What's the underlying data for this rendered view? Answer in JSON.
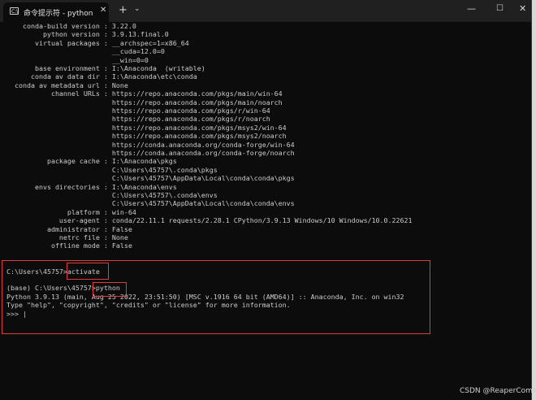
{
  "titlebar": {
    "tab_title": "命令提示符 - python",
    "tab_icon": "C:\\",
    "close_tab": "✕",
    "new_tab": "+",
    "dropdown": "⌄",
    "minimize": "—",
    "maximize": "☐",
    "close": "✕"
  },
  "console": {
    "lines": [
      "    conda-build version : 3.22.0",
      "         python version : 3.9.13.final.0",
      "       virtual packages : __archspec=1=x86_64",
      "                          __cuda=12.0=0",
      "                          __win=0=0",
      "       base environment : I:\\Anaconda  (writable)",
      "      conda av data dir : I:\\Anaconda\\etc\\conda",
      "  conda av metadata url : None",
      "           channel URLs : https://repo.anaconda.com/pkgs/main/win-64",
      "                          https://repo.anaconda.com/pkgs/main/noarch",
      "                          https://repo.anaconda.com/pkgs/r/win-64",
      "                          https://repo.anaconda.com/pkgs/r/noarch",
      "                          https://repo.anaconda.com/pkgs/msys2/win-64",
      "                          https://repo.anaconda.com/pkgs/msys2/noarch",
      "                          https://conda.anaconda.org/conda-forge/win-64",
      "                          https://conda.anaconda.org/conda-forge/noarch",
      "          package cache : I:\\Anaconda\\pkgs",
      "                          C:\\Users\\45757\\.conda\\pkgs",
      "                          C:\\Users\\45757\\AppData\\Local\\conda\\conda\\pkgs",
      "       envs directories : I:\\Anaconda\\envs",
      "                          C:\\Users\\45757\\.conda\\envs",
      "                          C:\\Users\\45757\\AppData\\Local\\conda\\conda\\envs",
      "               platform : win-64",
      "             user-agent : conda/22.11.1 requests/2.28.1 CPython/3.9.13 Windows/10 Windows/10.0.22621",
      "          administrator : False",
      "             netrc file : None",
      "           offline mode : False",
      "",
      "",
      "C:\\Users\\45757>activate",
      "",
      "(base) C:\\Users\\45757>python",
      "Python 3.9.13 (main, Aug 25 2022, 23:51:50) [MSC v.1916 64 bit (AMD64)] :: Anaconda, Inc. on win32",
      "Type \"help\", \"copyright\", \"credits\" or \"license\" for more information.",
      ">>> |"
    ]
  },
  "watermark": "CSDN @ReaperCome"
}
